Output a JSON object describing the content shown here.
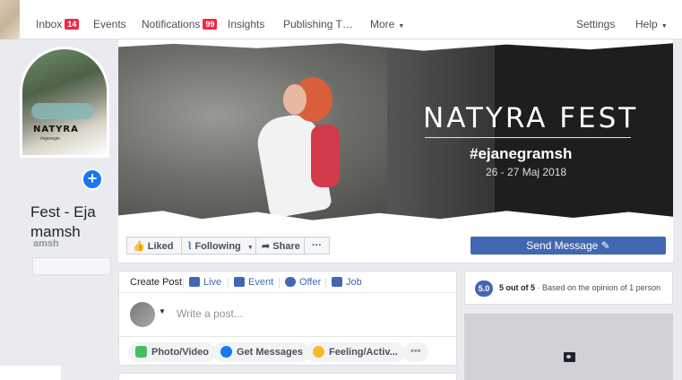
{
  "nav": {
    "inbox": "Inbox",
    "inbox_count": "14",
    "events": "Events",
    "notifications": "Notifications",
    "notifications_count": "99",
    "insights": "Insights",
    "publishing": "Publishing T…",
    "more": "More",
    "settings": "Settings",
    "help": "Help"
  },
  "profile": {
    "pic_text": "NATYRA",
    "pic_sub": "#ejanegm",
    "name": "Fest - Eja mamsh",
    "handle": "amsh"
  },
  "cover": {
    "title": "NATYRA FEST",
    "hashtag": "#ejanegramsh",
    "date": "26 - 27 Maj 2018"
  },
  "actions": {
    "liked": "Liked",
    "following": "Following",
    "share": "Share",
    "more": "···",
    "send_message": "Send Message"
  },
  "composer": {
    "tabs": [
      "Create Post",
      "Live",
      "Event",
      "Offer",
      "Job"
    ],
    "placeholder": "Write a post...",
    "buttons": [
      "Photo/Video",
      "Get Messages",
      "Feeling/Activ...",
      "•••"
    ]
  },
  "rating": {
    "score": "5.0",
    "summary": "5 out of 5",
    "detail": " · Based on the opinion of 1 person"
  },
  "colors": {
    "brand": "#4267b2",
    "badge": "#f02849"
  },
  "icons": [
    "thumbs-up-icon",
    "rss-icon",
    "share-arrow-icon",
    "pencil-icon",
    "live-icon",
    "calendar-icon",
    "offer-icon",
    "job-icon",
    "photo-icon",
    "messenger-icon",
    "smile-icon",
    "add-photo-icon"
  ]
}
